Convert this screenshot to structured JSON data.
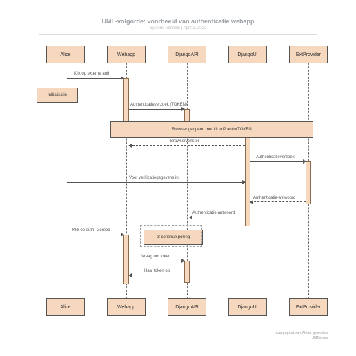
{
  "title": "UML-volgorde: voorbeeld van authenticatie webapp",
  "subtitle": "System Tutorials  |  April 2, 2020",
  "actors": [
    "Alice",
    "Webapp",
    "DjangoAPI",
    "DjangoUI",
    "ExtProvider"
  ],
  "notes": {
    "init": "Initialisatie",
    "browser_open": "Browser geopend met UI uri? auth=TOKEN",
    "polling": "of continue polling"
  },
  "labels": {
    "m1": "Klik op externe auth",
    "m2": "Authenticatieverzoek (TOKEN)",
    "m3": "Browservenster",
    "m4": "Authenticatieverzoek",
    "m5": "Voer verificatiegegevens in",
    "m6": "Authenticatie-antwoord",
    "m7": "Authenticatie-antwoord",
    "m8": "Klik op auth. Gereed",
    "m9": "Vraag om token",
    "m10": "Haal token op"
  },
  "footer_l1": "Aangepast van Alteia-gebruiker",
  "footer_l2": "JMBerger",
  "chart_data": {
    "type": "uml-sequence",
    "title": "UML-volgorde: voorbeeld van authenticatie webapp",
    "participants": [
      "Alice",
      "Webapp",
      "DjangoAPI",
      "DjangoUI",
      "ExtProvider"
    ],
    "messages": [
      {
        "from": "Alice",
        "to": "Webapp",
        "text": "Klik op externe auth",
        "style": "solid"
      },
      {
        "from": "Alice",
        "to": "Alice",
        "text": "Initialisatie",
        "style": "note"
      },
      {
        "from": "Webapp",
        "to": "DjangoAPI",
        "text": "Authenticatieverzoek (TOKEN)",
        "style": "solid"
      },
      {
        "from": "Webapp",
        "to": "ExtProvider",
        "text": "Browser geopend met UI uri? auth=TOKEN",
        "style": "span"
      },
      {
        "from": "DjangoUI",
        "to": "Webapp",
        "text": "Browservenster",
        "style": "dashed"
      },
      {
        "from": "DjangoUI",
        "to": "ExtProvider",
        "text": "Authenticatieverzoek",
        "style": "solid"
      },
      {
        "from": "Alice",
        "to": "DjangoUI",
        "text": "Voer verificatiegegevens in",
        "style": "solid"
      },
      {
        "from": "ExtProvider",
        "to": "DjangoUI",
        "text": "Authenticatie-antwoord",
        "style": "dashed"
      },
      {
        "from": "DjangoUI",
        "to": "DjangoAPI",
        "text": "Authenticatie-antwoord",
        "style": "dashed"
      },
      {
        "from": "Alice",
        "to": "Webapp",
        "text": "Klik op auth. Gereed",
        "style": "solid"
      },
      {
        "from": "Webapp",
        "to": "Webapp",
        "text": "of continue polling",
        "style": "note"
      },
      {
        "from": "Webapp",
        "to": "DjangoAPI",
        "text": "Vraag om token",
        "style": "solid"
      },
      {
        "from": "DjangoAPI",
        "to": "Webapp",
        "text": "Haal token op",
        "style": "dashed"
      }
    ]
  }
}
